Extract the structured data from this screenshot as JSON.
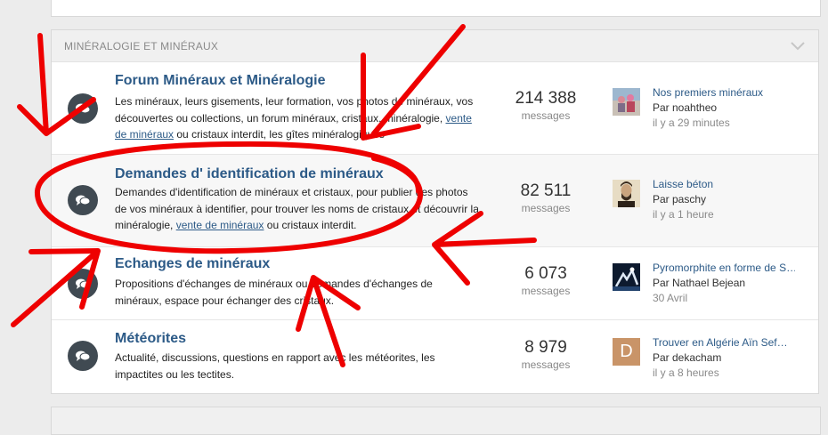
{
  "category": {
    "title": "MINÉRALOGIE ET MINÉRAUX",
    "toggle_icon": "chevron-down-icon"
  },
  "nodes": [
    {
      "title": "Forum Minéraux et Minéralogie",
      "desc_before": "Les minéraux, leurs gisements, leur formation, vos photos de minéraux, vos découvertes ou collections, un forum minéraux, cristaux, minéralogie, ",
      "desc_link": "vente de minéraux",
      "desc_after": " ou cristaux interdit, les gîtes minéralogiques",
      "messages": "214 388",
      "messages_label": "messages",
      "last_title": "Nos premiers minéraux",
      "last_user": "Par noahtheo",
      "last_time": "il y a 29 minutes"
    },
    {
      "title": "Demandes d' identification de minéraux",
      "desc_before": "Demandes d'identification de minéraux et cristaux, pour publier des photos de vos minéraux à identifier, pour trouver les noms de cristaux et découvrir la minéralogie, ",
      "desc_link": "vente de minéraux",
      "desc_after": " ou cristaux interdit.",
      "messages": "82 511",
      "messages_label": "messages",
      "last_title": "Laisse béton",
      "last_user": "Par paschy",
      "last_time": "il y a 1 heure"
    },
    {
      "title": "Echanges de minéraux",
      "desc_before": "Propositions d'échanges de minéraux ou demandes d'échanges de minéraux, espace pour échanger des cristaux.",
      "desc_link": "",
      "desc_after": "",
      "messages": "6 073",
      "messages_label": "messages",
      "last_title": "Pyromorphite en forme de S…",
      "last_user": "Par Nathael Bejean",
      "last_time": "30 Avril"
    },
    {
      "title": "Météorites",
      "desc_before": "Actualité, discussions, questions en rapport avec les météorites, les impactites ou les tectites.",
      "desc_link": "",
      "desc_after": "",
      "messages": "8 979",
      "messages_label": "messages",
      "last_title": "Trouver en Algérie Aïn Sef…",
      "last_user": "Par dekacham",
      "last_time": "il y a 8 heures",
      "avatar_letter": "D"
    }
  ],
  "colors": {
    "link": "#2c5a87",
    "icon_bg": "#404a52",
    "scribble": "#ee0000",
    "avatar_d": "#c99468"
  }
}
